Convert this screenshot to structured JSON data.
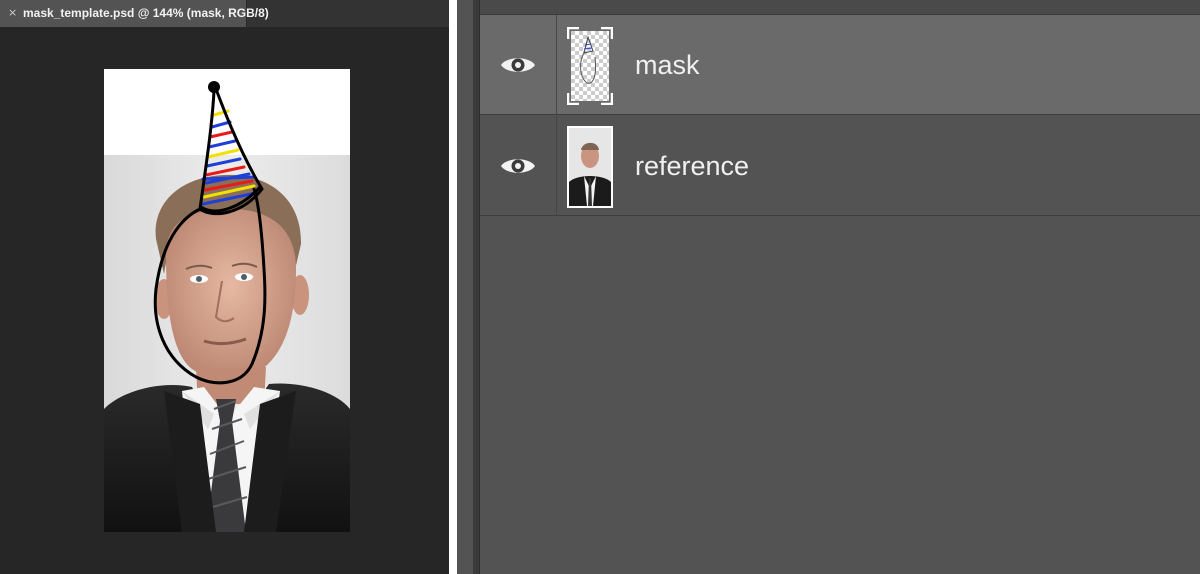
{
  "document": {
    "tab_close_glyph": "×",
    "tab_title": "mask_template.psd @ 144% (mask, RGB/8)"
  },
  "layers": [
    {
      "name": "mask",
      "visible": true,
      "selected": true,
      "thumbnail": "transparent-checkerboard-with-drawing"
    },
    {
      "name": "reference",
      "visible": true,
      "selected": false,
      "thumbnail": "portrait-photo"
    }
  ],
  "icons": {
    "visibility": "eye-icon",
    "tab_close": "close-icon"
  },
  "colors": {
    "doc_background": "#262626",
    "panel_background": "#535353",
    "selected_row": "#6a6a6a",
    "hat_stripes": [
      "#1f3fd6",
      "#e81b1b",
      "#f2e000"
    ]
  }
}
